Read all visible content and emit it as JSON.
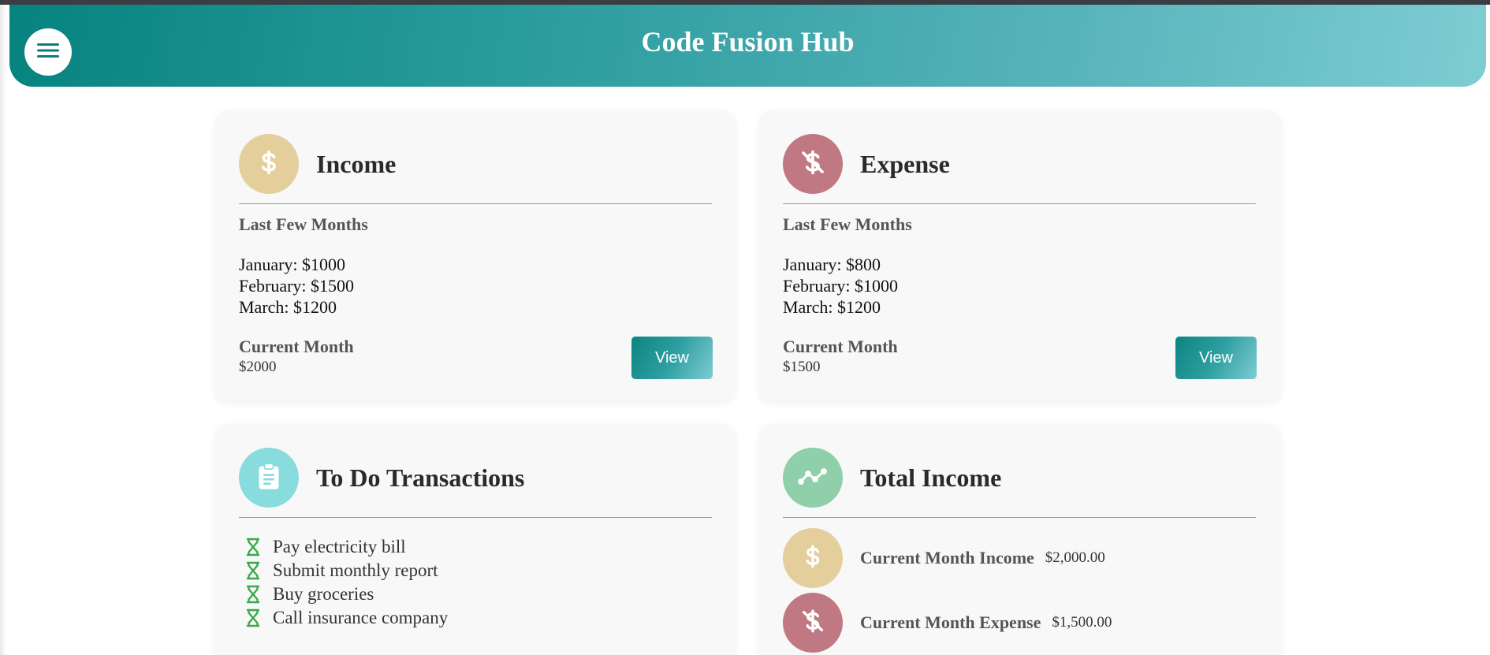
{
  "header": {
    "title": "Code Fusion Hub",
    "menu_icon": "hamburger-menu-icon"
  },
  "colors": {
    "teal_dark": "#06837f",
    "teal_light": "#7ecdd3",
    "income_gold": "#e4cf9c",
    "expense_rose": "#c07882",
    "todo_cyan": "#88dcdd",
    "total_green": "#8fcfaa",
    "hourglass_green": "#3aaa4a"
  },
  "income_card": {
    "title": "Income",
    "icon": "dollar-icon",
    "subtitle": "Last Few Months",
    "months": [
      "January: $1000",
      "February: $1500",
      "March: $1200"
    ],
    "current_label": "Current Month",
    "current_value": "$2000",
    "view_label": "View"
  },
  "expense_card": {
    "title": "Expense",
    "icon": "dollar-off-icon",
    "subtitle": "Last Few Months",
    "months": [
      "January: $800",
      "February: $1000",
      "March: $1200"
    ],
    "current_label": "Current Month",
    "current_value": "$1500",
    "view_label": "View"
  },
  "todo_card": {
    "title": "To Do Transactions",
    "icon": "clipboard-icon",
    "item_icon": "hourglass-icon",
    "items": [
      "Pay electricity bill",
      "Submit monthly report",
      "Buy groceries",
      "Call insurance company"
    ]
  },
  "total_card": {
    "title": "Total Income",
    "icon": "trend-line-icon",
    "rows": [
      {
        "label": "Current Month Income",
        "value": "$2,000.00",
        "icon": "dollar-icon"
      },
      {
        "label": "Current Month Expense",
        "value": "$1,500.00",
        "icon": "dollar-off-icon"
      }
    ]
  }
}
